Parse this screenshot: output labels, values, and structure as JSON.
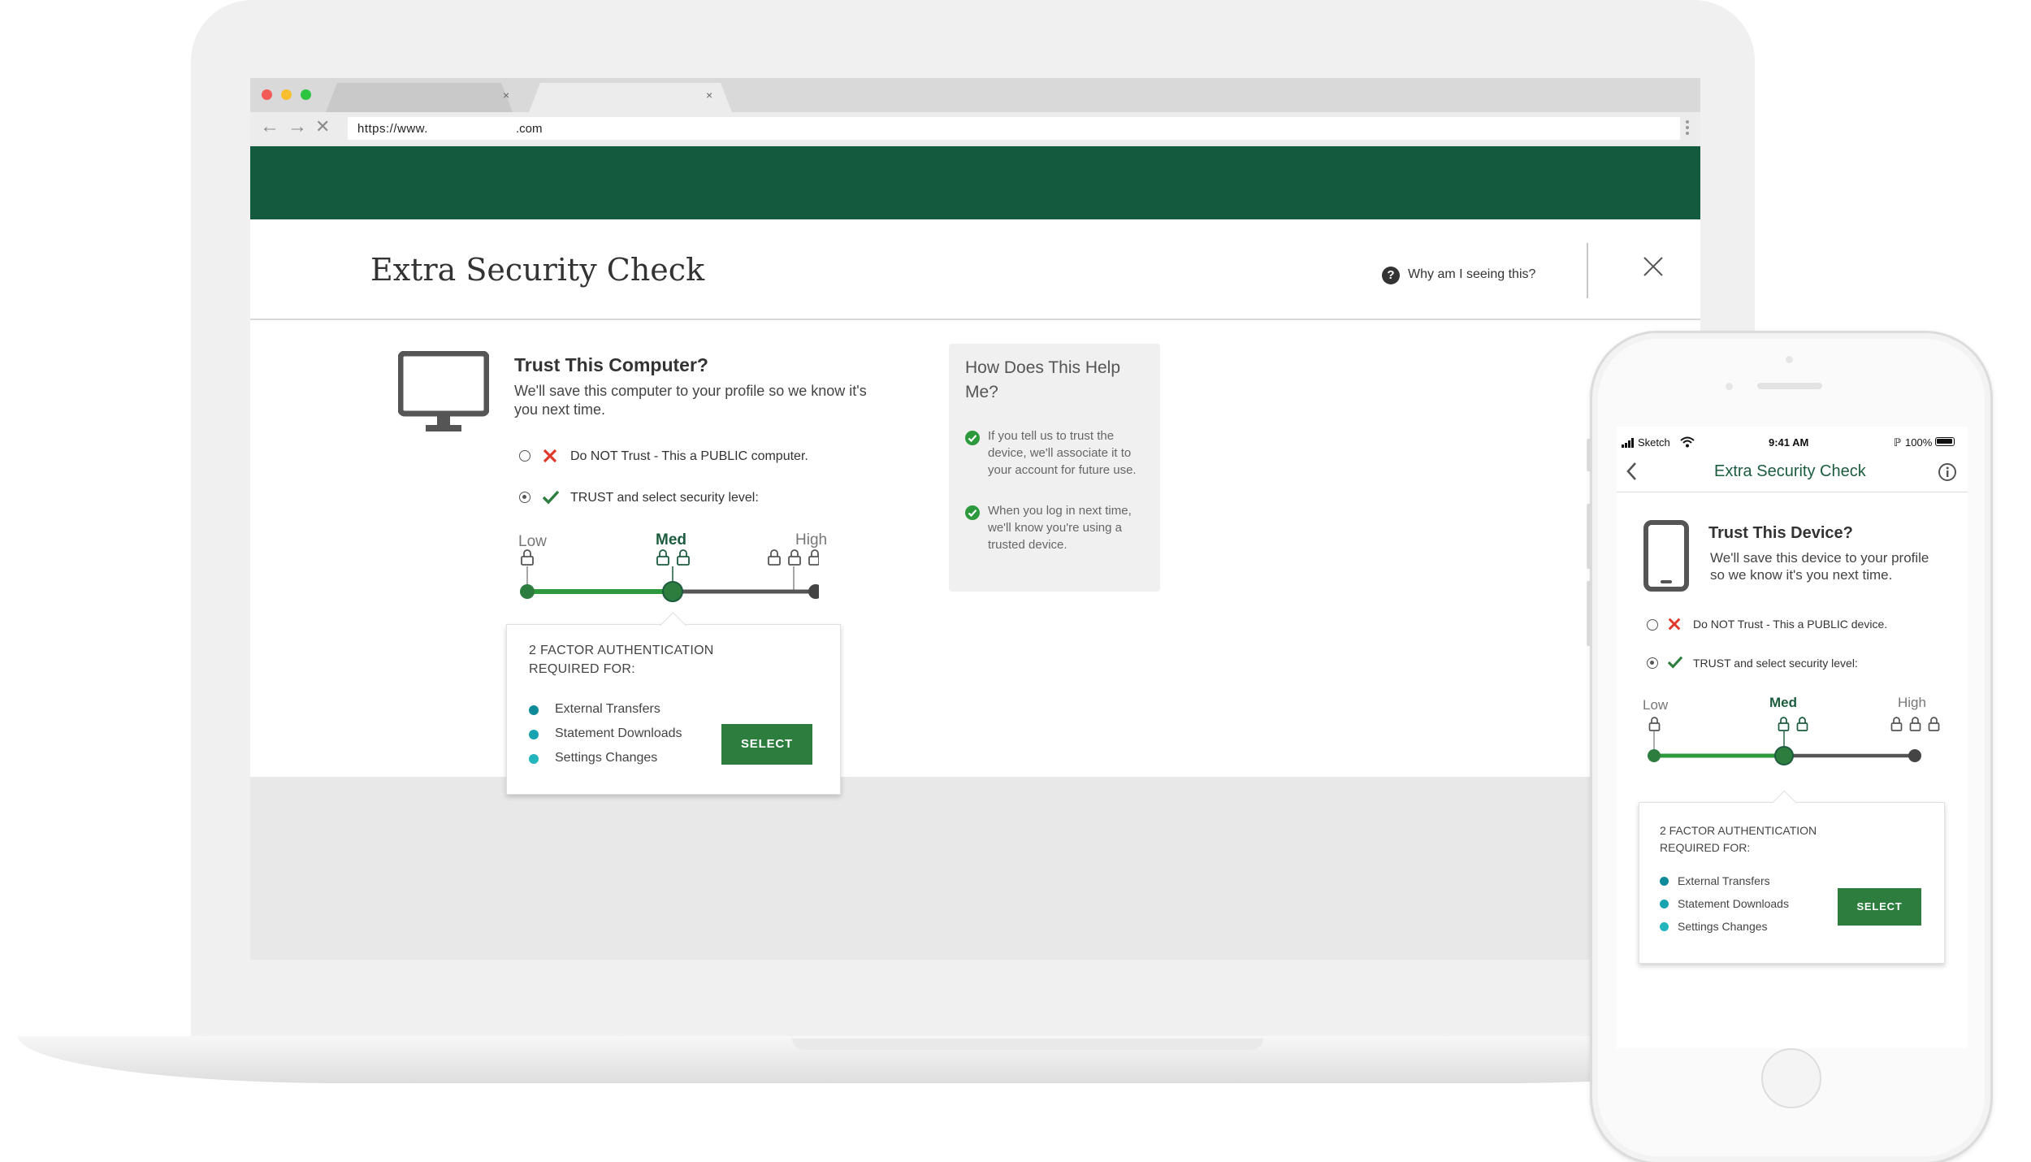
{
  "browser": {
    "url_prefix": "https://www.",
    "url_suffix": ".com",
    "tab_close": "×"
  },
  "desktop": {
    "title": "Extra Security Check",
    "help_link": "Why am I seeing this?",
    "help_icon": "?",
    "question_title": "Trust This Computer?",
    "question_sub": "We'll save this computer to your profile so we know it's you next time.",
    "option_no": "Do NOT Trust  - This a PUBLIC computer.",
    "option_yes": "TRUST and select security level:",
    "levels": {
      "low": "Low",
      "med": "Med",
      "high": "High"
    },
    "selected_level_fraction": 0.5,
    "popup_heading_1": "2 FACTOR AUTHENTICATION",
    "popup_heading_2": "REQUIRED FOR:",
    "items": [
      "External Transfers",
      "Statement Downloads",
      "Settings Changes"
    ],
    "select_button": "SELECT",
    "info": {
      "title": "How Does This Help Me?",
      "point1": "If you tell us to trust the device,  we'll associate it to your account for future use.",
      "point2": "When you log in next time, we'll know you're using a trusted device."
    }
  },
  "mobile": {
    "carrier": "Sketch",
    "time": "9:41 AM",
    "battery": "100%",
    "title": "Extra Security Check",
    "question_title": "Trust This Device?",
    "question_sub": "We'll save this device to your profile so we know it's you next time.",
    "option_no": "Do NOT Trust  - This a PUBLIC device.",
    "option_yes": "TRUST and select security level:",
    "levels": {
      "low": "Low",
      "med": "Med",
      "high": "High"
    },
    "selected_level_fraction": 0.5,
    "popup_heading_1": "2 FACTOR AUTHENTICATION",
    "popup_heading_2": "REQUIRED FOR:",
    "items": [
      "External Transfers",
      "Statement Downloads",
      "Settings Changes"
    ],
    "select_button": "SELECT"
  },
  "colors": {
    "brand_green": "#145a3f",
    "accent_green": "#2c7d3e",
    "x_red": "#e0392b",
    "bullet_1": "#0e8a9a",
    "bullet_2": "#18a3b0",
    "bullet_3": "#22b5be"
  }
}
